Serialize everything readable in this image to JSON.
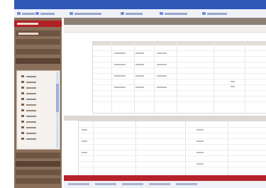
{
  "window": {
    "title": ""
  },
  "toolbar": {
    "items": [
      {
        "icon": "back-icon",
        "label": ""
      },
      {
        "icon": "forward-icon",
        "label": ""
      },
      {
        "icon": "home-icon",
        "label": ""
      },
      {
        "icon": "print-icon",
        "label": ""
      },
      {
        "icon": "refresh-icon",
        "label": ""
      },
      {
        "icon": "help-icon",
        "label": ""
      }
    ]
  },
  "sidebar": {
    "sections": [
      "",
      "",
      "",
      ""
    ]
  },
  "main": {
    "header_title": "",
    "tabs": [
      "",
      "",
      ""
    ]
  },
  "colors": {
    "titlebar": "#2f58b8",
    "sidebar": "#8a6f5a",
    "accent_red": "#b21f24",
    "grid_header": "#e2ddd8"
  }
}
